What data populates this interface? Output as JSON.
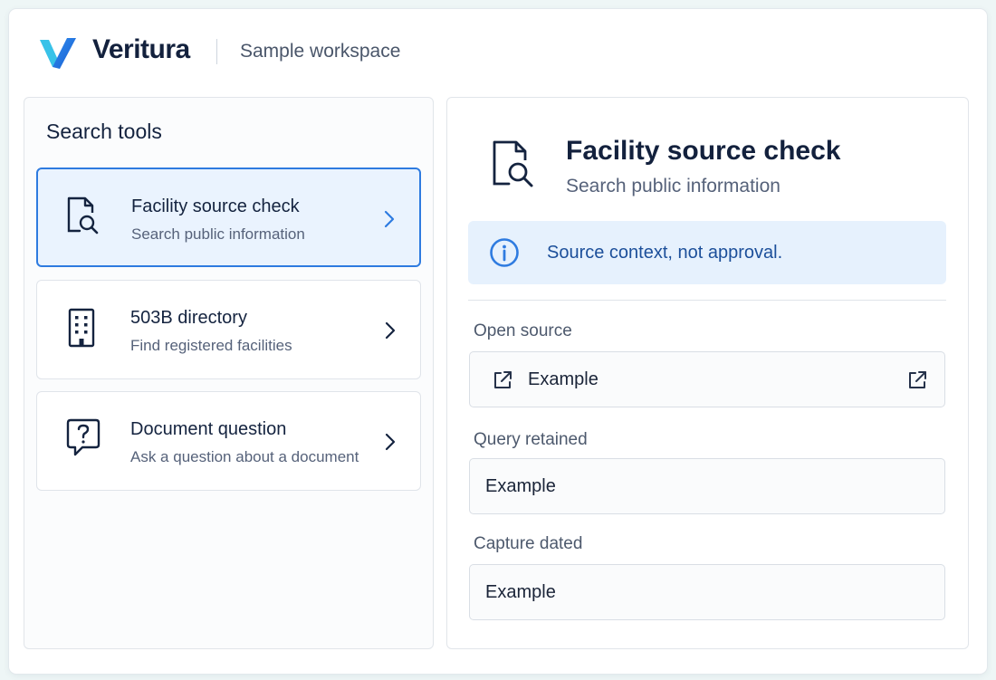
{
  "app": {
    "brand": "Veritura",
    "workspace": "Sample workspace",
    "accent_color": "#2e7be0",
    "logo_icon": "veritura-v-logo"
  },
  "sidebar": {
    "title": "Search tools",
    "items": [
      {
        "title": "Facility source check",
        "subtitle": "Search public information",
        "icon": "document-search-icon",
        "selected": true
      },
      {
        "title": "503B directory",
        "subtitle": "Find registered facilities",
        "icon": "building-icon",
        "selected": false
      },
      {
        "title": "Document question",
        "subtitle": "Ask a question about a document",
        "icon": "question-bubble-icon",
        "selected": false
      }
    ]
  },
  "detail": {
    "title": "Facility source check",
    "subtitle": "Search public information",
    "notice": "Source context, not approval.",
    "fields": {
      "open_source": {
        "label": "Open source",
        "value": "Example"
      },
      "query_retained": {
        "label": "Query retained",
        "value": "Example"
      },
      "capture_dated": {
        "label": "Capture dated",
        "value": "Example"
      }
    }
  }
}
